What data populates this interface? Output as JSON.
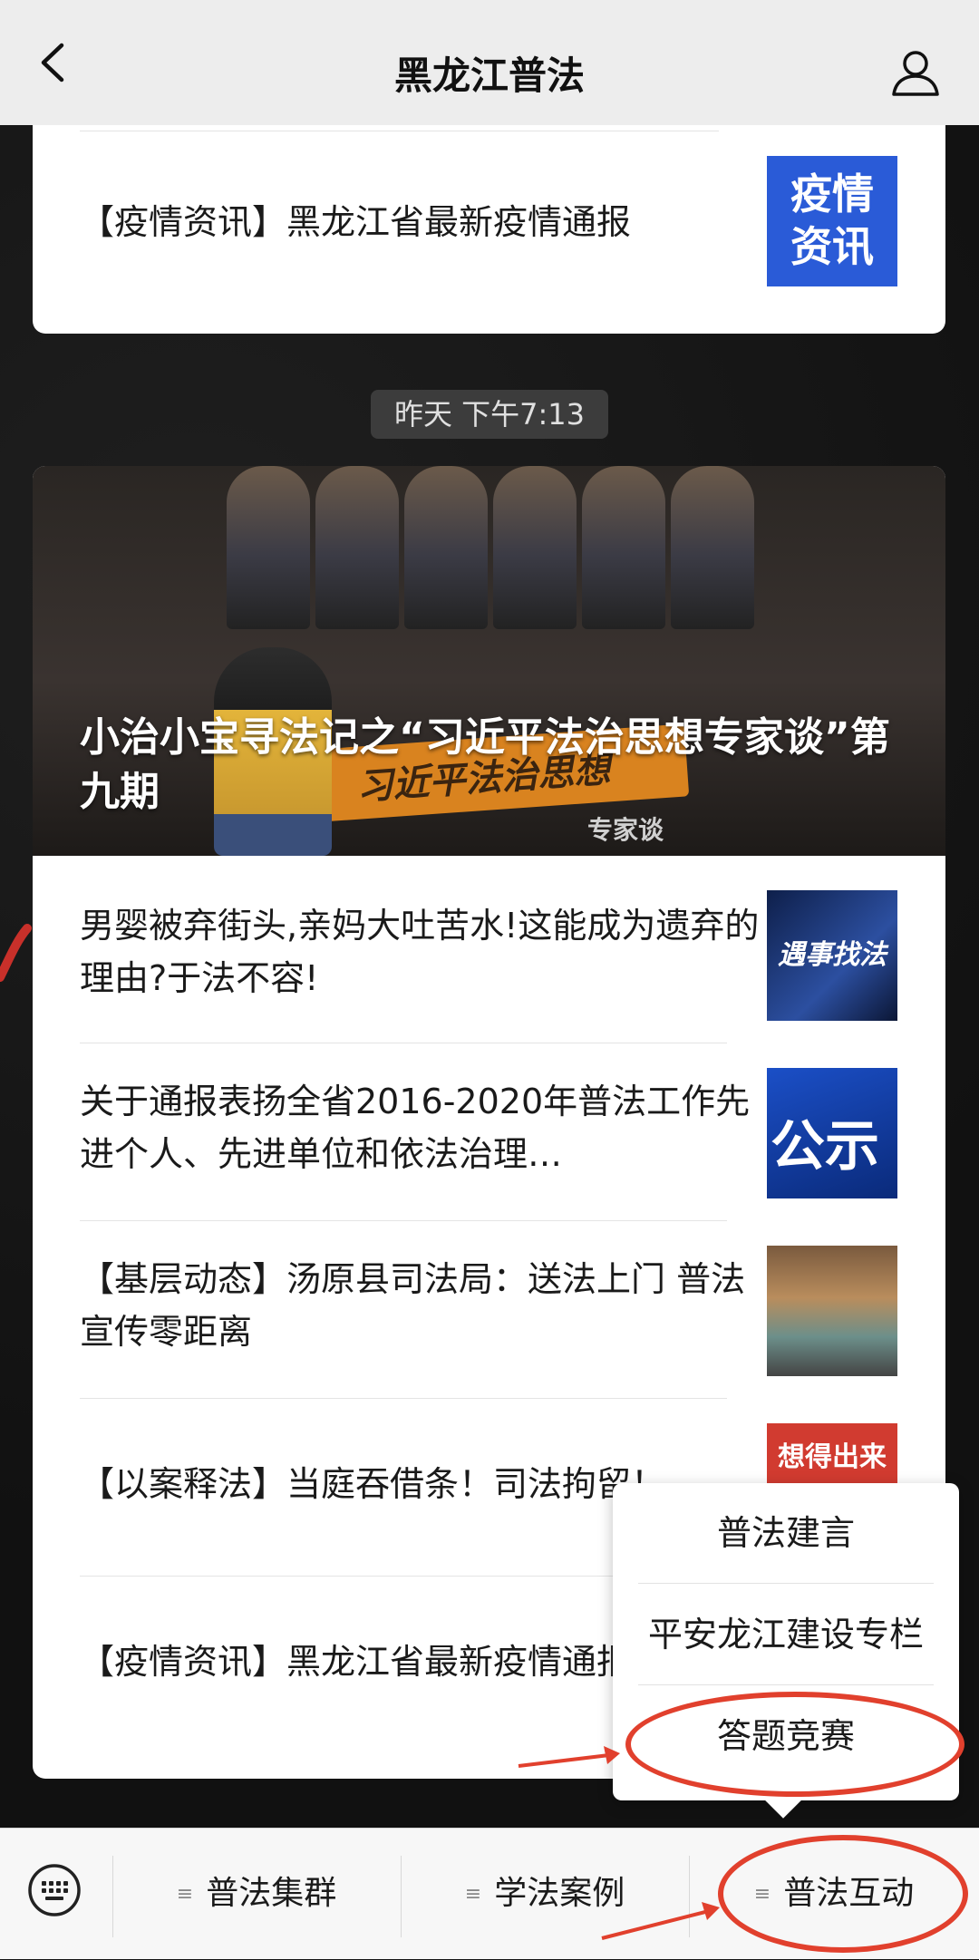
{
  "header": {
    "title": "黑龙江普法"
  },
  "card1": {
    "item_text": "【疫情资讯】黑龙江省最新疫情通报",
    "thumb_text_line1": "疫情",
    "thumb_text_line2": "资讯"
  },
  "timestamp": "昨天 下午7:13",
  "card2": {
    "hero_title": "小治小宝寻法记之“习近平法治思想专家谈”第九期",
    "hero_banner_text": "习近平法治思想",
    "hero_badge_text": "专家谈",
    "items": [
      {
        "text": "男婴被弃街头,亲妈大吐苦水!这能成为遗弃的理由?于法不容!",
        "thumb_text": "遇事找法"
      },
      {
        "text": "关于通报表扬全省2016-2020年普法工作先进个人、先进单位和依法治理…",
        "thumb_text": "公示"
      },
      {
        "text": "【基层动态】汤原县司法局：送法上门 普法宣传零距离",
        "thumb_text": ""
      },
      {
        "text": "【以案释法】当庭吞借条！司法拘留！",
        "thumb_text": "想得出来"
      },
      {
        "text": "【疫情资讯】黑龙江省最新疫情通报",
        "thumb_text": ""
      }
    ]
  },
  "popup_menu": {
    "items": [
      "普法建言",
      "平安龙江建设专栏",
      "答题竞赛"
    ]
  },
  "bottom_tabs": [
    "普法集群",
    "学法案例",
    "普法互动"
  ],
  "colors": {
    "annotation_red": "#e1402d",
    "thumb_blue": "#2a5bd7"
  }
}
